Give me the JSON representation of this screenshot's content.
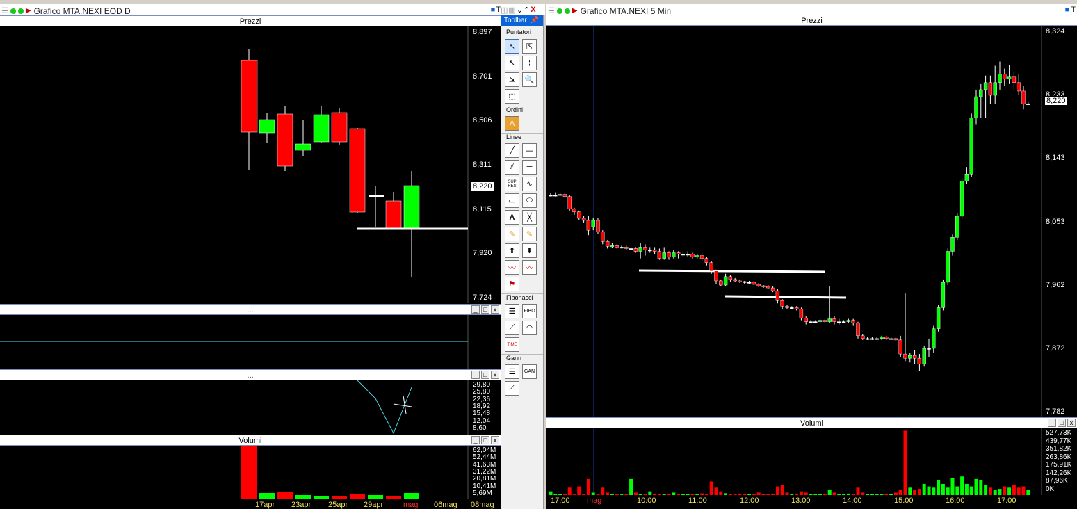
{
  "left_window": {
    "title": "Grafico MTA.NEXI EOD D",
    "price_pane": {
      "title": "Prezzi",
      "ticks": [
        "8,897",
        "8,701",
        "8,506",
        "8,311",
        "8,115",
        "7,920",
        "7,724"
      ],
      "last_price": "8,220"
    },
    "pane2": {
      "title": "..."
    },
    "pane3": {
      "title": "...",
      "ticks": [
        "29,80",
        "25,80",
        "22,36",
        "18,92",
        "15,48",
        "12,04",
        "8,60"
      ]
    },
    "volume_pane": {
      "title": "Volumi",
      "ticks": [
        "62,04M",
        "52,44M",
        "41,63M",
        "31,22M",
        "20,81M",
        "10,41M",
        "5,69M"
      ]
    },
    "date_labels": [
      "17apr",
      "23apr",
      "25apr",
      "29apr",
      "mag",
      "06mag",
      "08mag"
    ]
  },
  "toolbar": {
    "title": "Toolbar",
    "sections": [
      "Puntatori",
      "Ordini",
      "Linee",
      "Fibonacci",
      "Gann"
    ],
    "tool_labels": {
      "supres": "SUP RES",
      "fibo": "FIBO",
      "time": "TIME",
      "gan": "GAN"
    }
  },
  "right_window": {
    "title": "Grafico MTA.NEXI 5 Min",
    "price_pane": {
      "title": "Prezzi",
      "ticks": [
        "8,324",
        "8,233",
        "8,143",
        "8,053",
        "7,962",
        "7,872",
        "7,782"
      ],
      "last_price": "8,220"
    },
    "volume_pane": {
      "title": "Volumi",
      "ticks": [
        "527,73K",
        "439,77K",
        "351,82K",
        "263,86K",
        "175,91K",
        "142,26K",
        "87,96K",
        "0K"
      ]
    },
    "time_labels": [
      "17:00",
      "mag",
      "10:00",
      "11:00",
      "12:00",
      "13:00",
      "14:00",
      "15:00",
      "16:00",
      "17:00"
    ]
  },
  "colors": {
    "up": "#00ff00",
    "down": "#ff0000",
    "accent": "#0a64d8",
    "cyan": "#4fd7e8"
  }
}
